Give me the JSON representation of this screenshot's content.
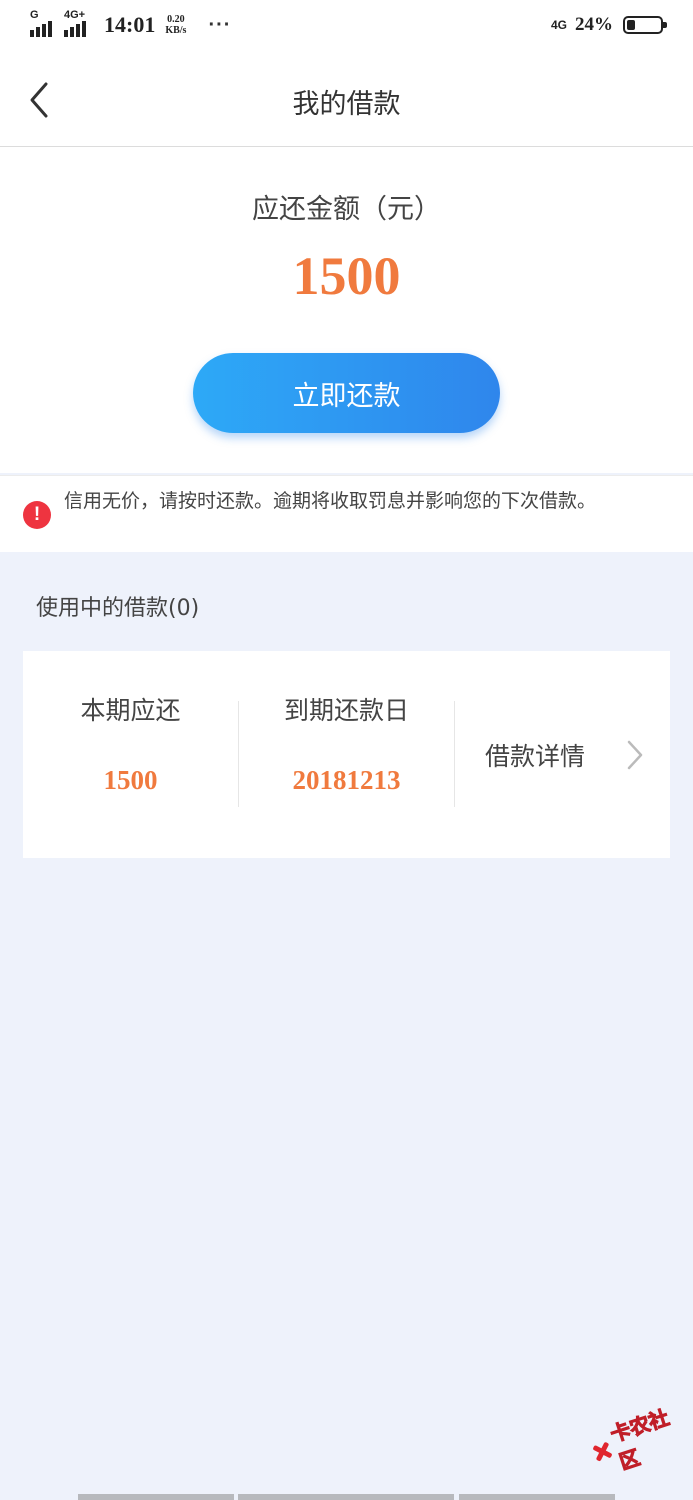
{
  "status_bar": {
    "signal1_label": "G",
    "signal2_label": "4G+",
    "time": "14:01",
    "speed_value": "0.20",
    "speed_unit": "KB/s",
    "more": "···",
    "network": "4G",
    "battery_percent": "24%",
    "battery_level": 0.24
  },
  "nav": {
    "back_icon": "chevron-left-icon",
    "title": "我的借款"
  },
  "amount": {
    "label": "应还金额（元）",
    "value": "1500",
    "repay_button": "立即还款",
    "accent_color": "#f07a3e",
    "button_color": "#2f86ec"
  },
  "notice": {
    "icon": "exclamation-icon",
    "text": "信用无价，请按时还款。逾期将收取罚息并影响您的下次借款。"
  },
  "loans": {
    "section_title": "使用中的借款(0)",
    "current_due_label": "本期应还",
    "current_due_value": "1500",
    "due_date_label": "到期还款日",
    "due_date_value": "20181213",
    "detail_label": "借款详情",
    "detail_icon": "chevron-right-icon"
  },
  "watermark": {
    "text": "卡农社区"
  }
}
